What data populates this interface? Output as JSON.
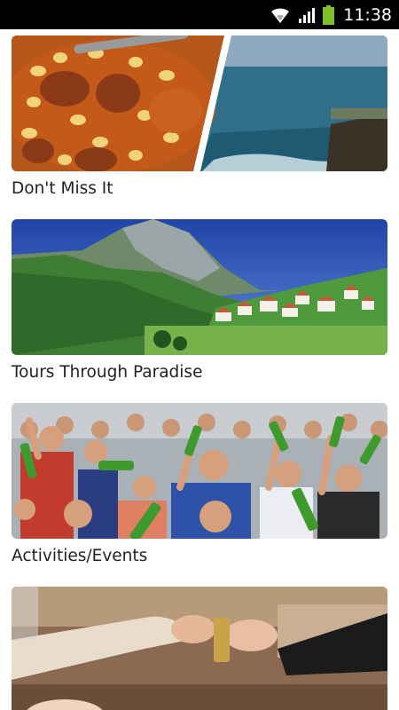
{
  "status_bar": {
    "time": "11:38",
    "icons": [
      "wifi-icon",
      "signal-icon",
      "battery-icon"
    ],
    "battery_color": "#7cc02b"
  },
  "cards": [
    {
      "label": "Don't Miss It",
      "image": "food-and-coast-image"
    },
    {
      "label": "Tours Through Paradise",
      "image": "mountain-village-image"
    },
    {
      "label": "Activities/Events",
      "image": "crowd-with-bottles-image"
    },
    {
      "label": "",
      "image": "hands-exchange-image"
    }
  ]
}
